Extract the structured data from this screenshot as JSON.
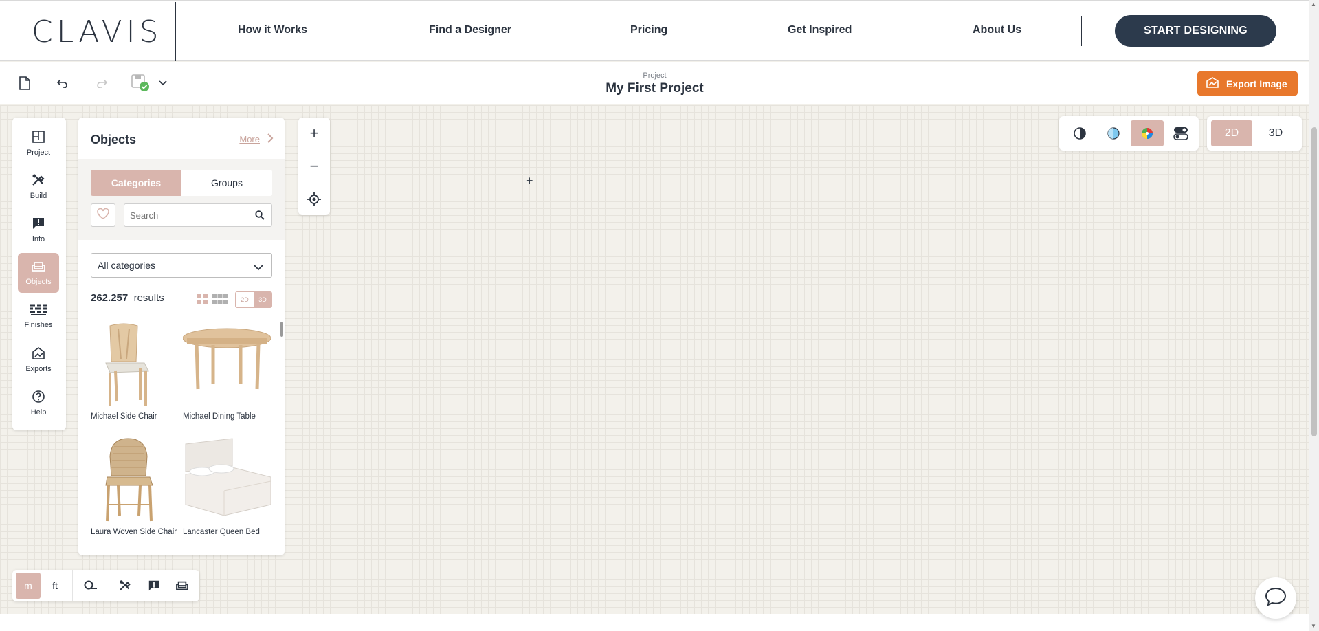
{
  "brand": {
    "logo": "CLAVIS"
  },
  "nav": {
    "links": [
      "How it Works",
      "Find a Designer",
      "Pricing",
      "Get Inspired",
      "About Us"
    ],
    "cta": "START DESIGNING"
  },
  "toolbar": {
    "project_label": "Project",
    "project_title": "My First Project",
    "export_label": "Export Image"
  },
  "sidebar": {
    "items": [
      {
        "label": "Project",
        "icon": "floorplan-icon"
      },
      {
        "label": "Build",
        "icon": "tools-icon"
      },
      {
        "label": "Info",
        "icon": "info-comment-icon"
      },
      {
        "label": "Objects",
        "icon": "sofa-icon"
      },
      {
        "label": "Finishes",
        "icon": "bricks-icon"
      },
      {
        "label": "Exports",
        "icon": "export-icon"
      },
      {
        "label": "Help",
        "icon": "help-icon"
      }
    ],
    "active": "Objects"
  },
  "panel": {
    "title": "Objects",
    "more": "More",
    "tabs": {
      "categories": "Categories",
      "groups": "Groups"
    },
    "search_placeholder": "Search",
    "category_select": "All categories",
    "results_count": "262.257",
    "results_label": "results",
    "dim_toggle": {
      "two_d": "2D",
      "three_d": "3D"
    },
    "items": [
      {
        "name": "Michael Side Chair"
      },
      {
        "name": "Michael Dining Table"
      },
      {
        "name": "Laura Woven Side Chair"
      },
      {
        "name": "Lancaster Queen Bed"
      }
    ]
  },
  "view": {
    "two_d": "2D",
    "three_d": "3D"
  },
  "units": {
    "m": "m",
    "ft": "ft"
  },
  "colors": {
    "accent": "#d9b5ad",
    "navy": "#2c3a4c",
    "orange": "#e8782c"
  }
}
